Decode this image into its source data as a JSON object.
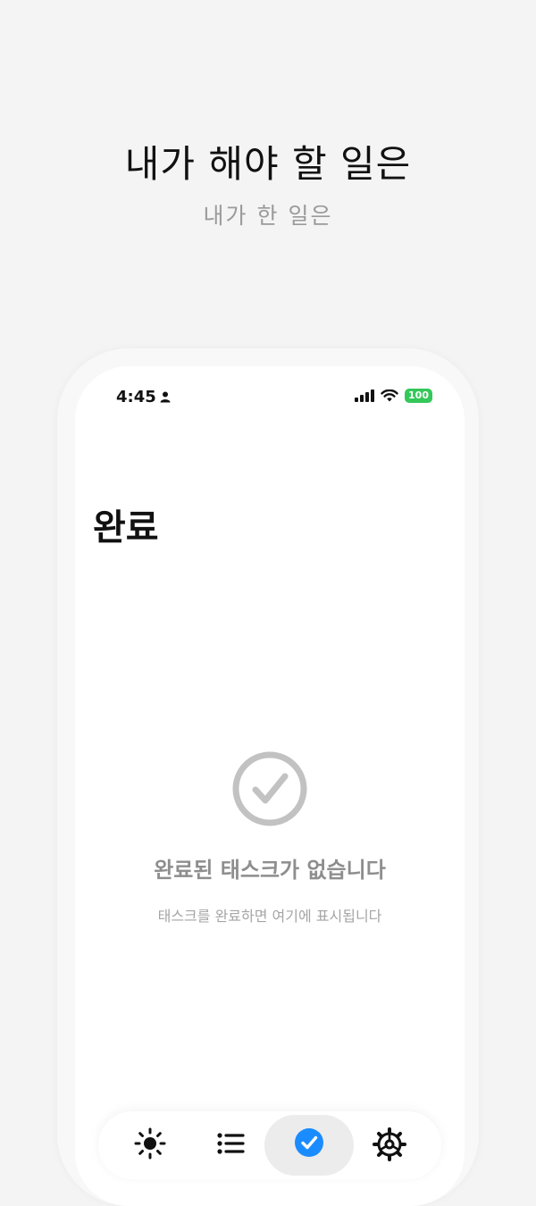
{
  "hero": {
    "title": "내가 해야 할 일은",
    "subtitle": "내가 한 일은"
  },
  "status_bar": {
    "time": "4:45",
    "battery": "100"
  },
  "screen": {
    "title": "완료",
    "empty_state": {
      "icon": "checkmark-circle-icon",
      "title": "완료된 태스크가 없습니다",
      "subtitle": "태스크를 완료하면 여기에 표시됩니다"
    }
  },
  "tab_bar": {
    "tabs": [
      {
        "icon": "sun-icon",
        "active": false
      },
      {
        "icon": "list-icon",
        "active": false
      },
      {
        "icon": "checkmark-circle-icon",
        "active": true
      },
      {
        "icon": "gear-icon",
        "active": false
      }
    ]
  },
  "colors": {
    "accent": "#1a8cff",
    "battery": "#34c759",
    "empty_gray": "#c2c2c2"
  }
}
